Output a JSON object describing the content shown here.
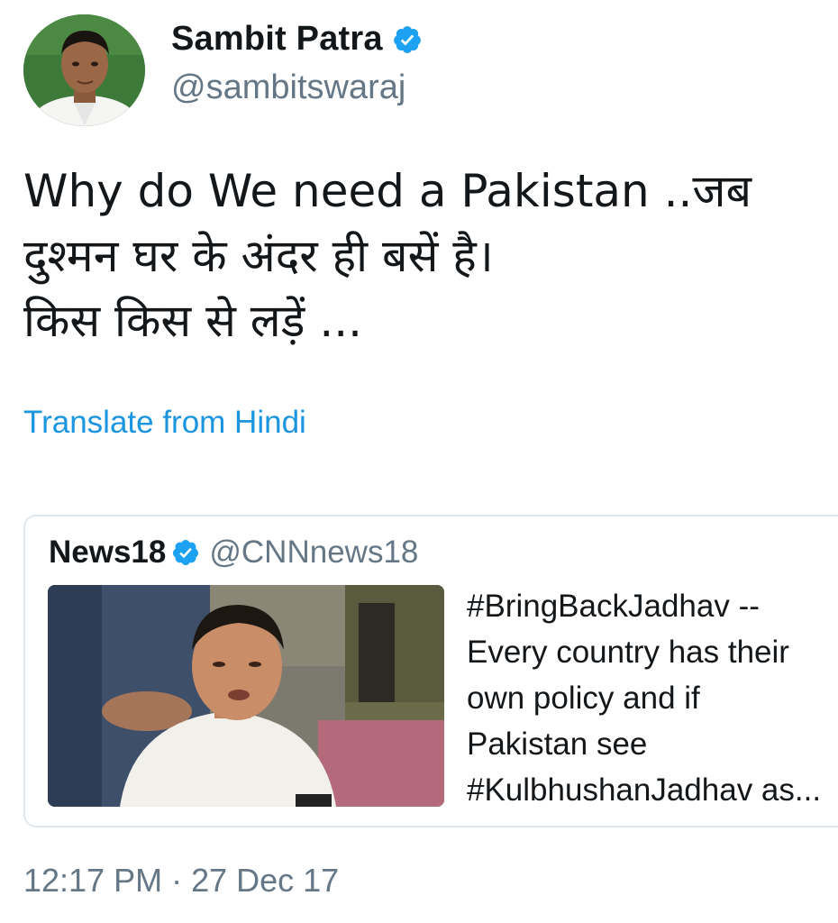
{
  "author": {
    "name": "Sambit Patra",
    "handle": "@sambitswaraj",
    "verified_icon": "verified-badge-icon",
    "avatar_icon": "profile-photo"
  },
  "tweet": {
    "lines": [
      "Why do We need a Pakistan ..जब",
      "दुश्मन घर के अंदर ही बसें है।",
      "किस किस से लड़ें ..."
    ],
    "translate_label": "Translate from Hindi",
    "timestamp": "12:17 PM · 27 Dec 17"
  },
  "quoted_tweet": {
    "name": "News18",
    "handle": "@CNNnews18",
    "verified_icon": "verified-badge-icon",
    "media_icon": "press-conference-photo",
    "lines": [
      "#BringBackJadhav --",
      "Every country has their",
      "own policy and if",
      "Pakistan see",
      "#KulbhushanJadhav as..."
    ]
  },
  "colors": {
    "link": "#1b95e0",
    "verified": "#1da1f2",
    "secondary_text": "#657786",
    "primary_text": "#14171a",
    "border": "#e1e8ed"
  }
}
